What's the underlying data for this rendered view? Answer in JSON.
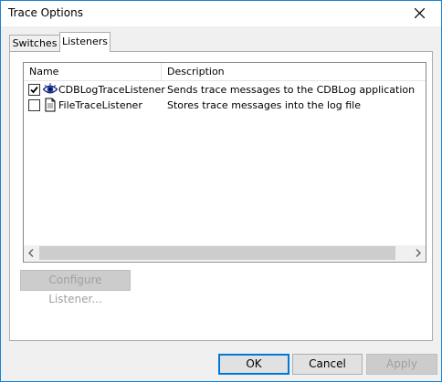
{
  "window": {
    "title": "Trace Options"
  },
  "tabs": [
    {
      "label": "Switches",
      "selected": false
    },
    {
      "label": "Listeners",
      "selected": true
    }
  ],
  "listview": {
    "columns": [
      "Name",
      "Description"
    ],
    "rows": [
      {
        "checked": true,
        "icon": "eye-icon",
        "name": "CDBLogTraceListener",
        "description": "Sends trace messages to the CDBLog application"
      },
      {
        "checked": false,
        "icon": "document-icon",
        "name": "FileTraceListener",
        "description": "Stores trace messages into the log file"
      }
    ]
  },
  "buttons": {
    "configure": "Configure Listener...",
    "ok": "OK",
    "cancel": "Cancel",
    "apply": "Apply"
  },
  "colors": {
    "accent": "#0078d7",
    "border": "#1883d7"
  }
}
